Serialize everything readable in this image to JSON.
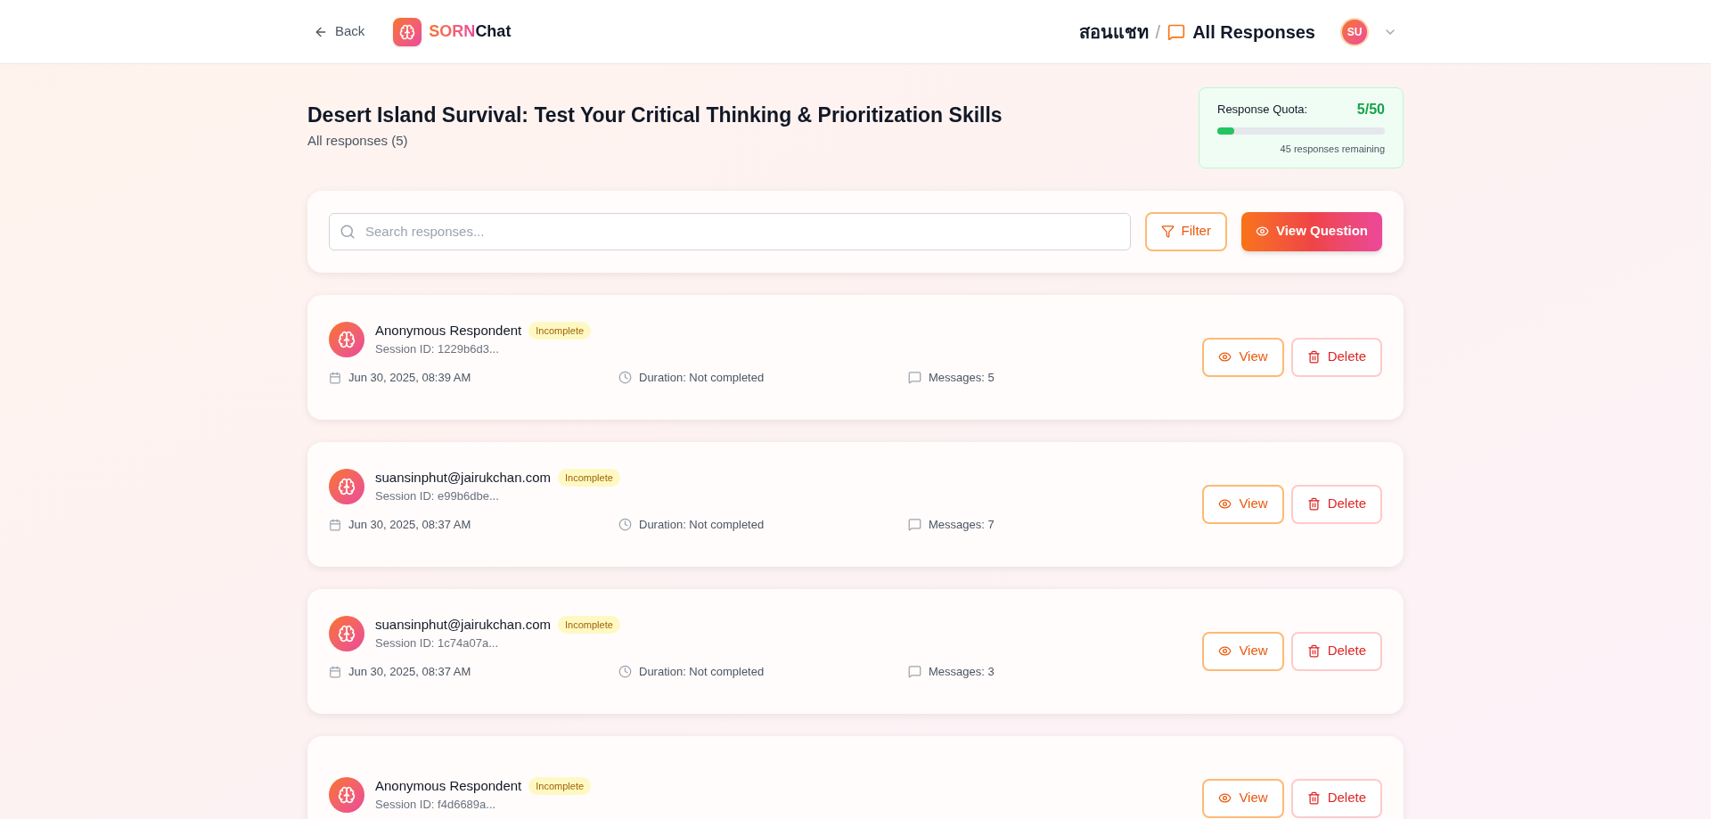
{
  "header": {
    "back": "Back",
    "logo": {
      "part1": "SORN",
      "part2": "Chat"
    },
    "breadcrumb": {
      "parent": "สอนแชท",
      "separator": "/",
      "current": "All Responses"
    },
    "avatar": "SU"
  },
  "title": "Desert Island Survival: Test Your Critical Thinking & Prioritization Skills",
  "subtitle": "All responses (5)",
  "quota": {
    "label": "Response Quota:",
    "value": "5/50",
    "level": 0.1,
    "remaining": "45 responses remaining"
  },
  "toolbar": {
    "search_placeholder": "Search responses...",
    "filter": "Filter",
    "view_question": "View Question"
  },
  "responses": [
    {
      "name": "Anonymous Respondent",
      "status": "Incomplete",
      "session": "Session ID: 1229b6d3...",
      "date": "Jun 30, 2025, 08:39 AM",
      "duration": "Duration: Not completed",
      "messages": "Messages: 5",
      "view": "View",
      "delete": "Delete"
    },
    {
      "name": "suansinphut@jairukchan.com",
      "status": "Incomplete",
      "session": "Session ID: e99b6dbe...",
      "date": "Jun 30, 2025, 08:37 AM",
      "duration": "Duration: Not completed",
      "messages": "Messages: 7",
      "view": "View",
      "delete": "Delete"
    },
    {
      "name": "suansinphut@jairukchan.com",
      "status": "Incomplete",
      "session": "Session ID: 1c74a07a...",
      "date": "Jun 30, 2025, 08:37 AM",
      "duration": "Duration: Not completed",
      "messages": "Messages: 3",
      "view": "View",
      "delete": "Delete"
    },
    {
      "name": "Anonymous Respondent",
      "status": "Incomplete",
      "session": "Session ID: f4d6689a...",
      "view": "View",
      "delete": "Delete"
    }
  ]
}
